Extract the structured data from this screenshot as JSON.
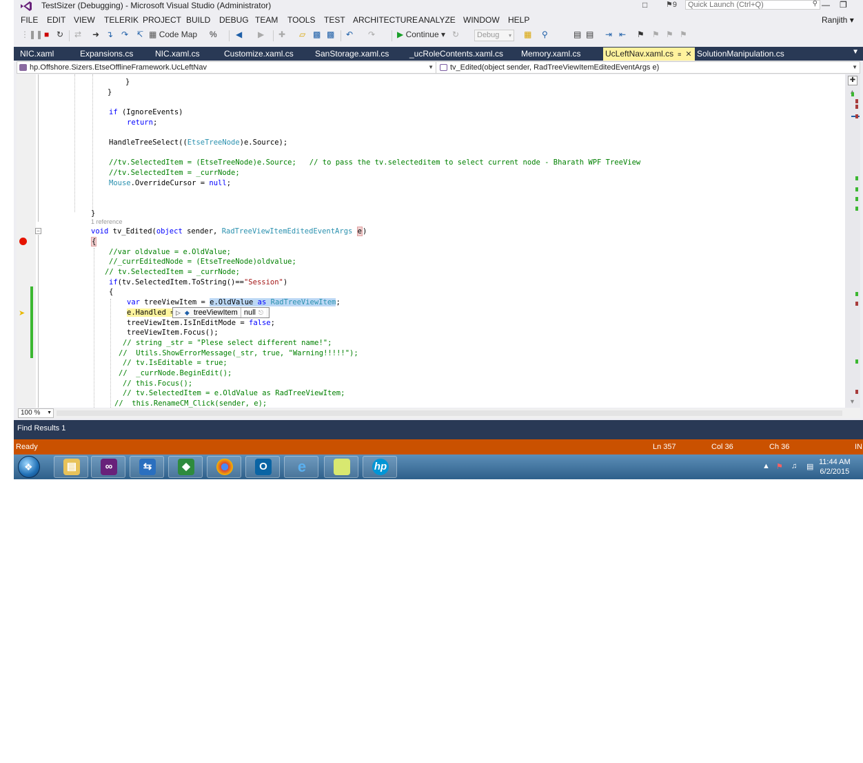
{
  "window": {
    "title": "TestSizer (Debugging) - Microsoft Visual Studio (Administrator)",
    "notification_count": "9",
    "quick_launch_placeholder": "Quick Launch (Ctrl+Q)",
    "user": "Ranjith"
  },
  "menu": [
    "FILE",
    "EDIT",
    "VIEW",
    "TELERIK",
    "PROJECT",
    "BUILD",
    "DEBUG",
    "TEAM",
    "TOOLS",
    "TEST",
    "ARCHITECTURE",
    "ANALYZE",
    "WINDOW",
    "HELP"
  ],
  "toolbar": {
    "code_map": "Code Map",
    "continue": "Continue",
    "config": "Debug"
  },
  "tabs": [
    {
      "label": "NIC.xaml"
    },
    {
      "label": "Expansions.cs"
    },
    {
      "label": "NIC.xaml.cs"
    },
    {
      "label": "Customize.xaml.cs"
    },
    {
      "label": "SanStorage.xaml.cs"
    },
    {
      "label": "_ucRoleContents.xaml.cs"
    },
    {
      "label": "Memory.xaml.cs"
    },
    {
      "label": "UcLeftNav.xaml.cs",
      "active": true
    },
    {
      "label": "SolutionManipulation.cs"
    }
  ],
  "navbar": {
    "type": "hp.Offshore.Sizers.EtseOfflineFramework.UcLeftNav",
    "member": "tv_Edited(object sender, RadTreeViewItemEditedEventArgs e)"
  },
  "code": {
    "close_brace": "}",
    "if_kw": "if",
    "ignore_events": " (IgnoreEvents)",
    "return_kw": "return",
    "handle_pre": "HandleTreeSelect((",
    "etse_tree_node": "EtseTreeNode",
    "handle_post": ")e.Source);",
    "comment1": "//tv.SelectedItem = (EtseTreeNode)e.Source;   // to pass the tv.selecteditem to select current node - Bharath WPF TreeView",
    "comment2": "//tv.SelectedItem = _currNode;",
    "mouse_type": "Mouse",
    "override_cursor": ".OverrideCursor = ",
    "null_kw": "null",
    "reference": "1 reference",
    "void_kw": "void",
    "method_name": " tv_Edited(",
    "object_kw": "object",
    "sender": " sender, ",
    "event_args_type": "RadTreeViewItemEditedEventArgs",
    "param_e": "e",
    "close_paren": ")",
    "open_brace": "{",
    "comment3": "//var oldvalue = e.OldValue;",
    "comment4": "//_currEditedNode = (EtseTreeNode)oldvalue;",
    "comment5": "// tv.SelectedItem = _currNode;",
    "if_session_pre": "(tv.SelectedItem.ToString()==",
    "session_str": "\"Session\"",
    "var_kw": "var",
    "tree_view_item": " treeViewItem = ",
    "old_value": "e.OldValue",
    "as_kw": "as",
    "rad_tree_view_item": "RadTreeViewItem",
    "e_handled": "e.Handled = tr",
    "is_edit_mode": "treeViewItem.IsInEditMode = ",
    "false_kw": "false",
    "focus": "treeViewItem.Focus();",
    "comment6": "// string _str = \"Plese select different name!\";",
    "comment7": "//  Utils.ShowErrorMessage(_str, true, \"Warning!!!!!\");",
    "comment8": "// tv.IsEditable = true;",
    "comment9": "//  _currNode.BeginEdit();",
    "comment10": "// this.Focus();",
    "comment11": "// tv.SelectedItem = e.OldValue as RadTreeViewItem;",
    "comment12": "//  this.RenameCM_Click(sender, e);"
  },
  "datatip": {
    "name": "treeViewItem",
    "value": "null"
  },
  "zoom": "100 %",
  "find_results": "Find Results 1",
  "status": {
    "ready": "Ready",
    "line": "Ln 357",
    "col": "Col 36",
    "ch": "Ch 36",
    "mode": "IN"
  },
  "taskbar": {
    "time": "11:44 AM",
    "date": "6/2/2015"
  },
  "colors": {
    "status_bar": "#ca5100",
    "tab_bar": "#293955",
    "active_tab": "#fff29d",
    "breakpoint": "#e51400"
  }
}
